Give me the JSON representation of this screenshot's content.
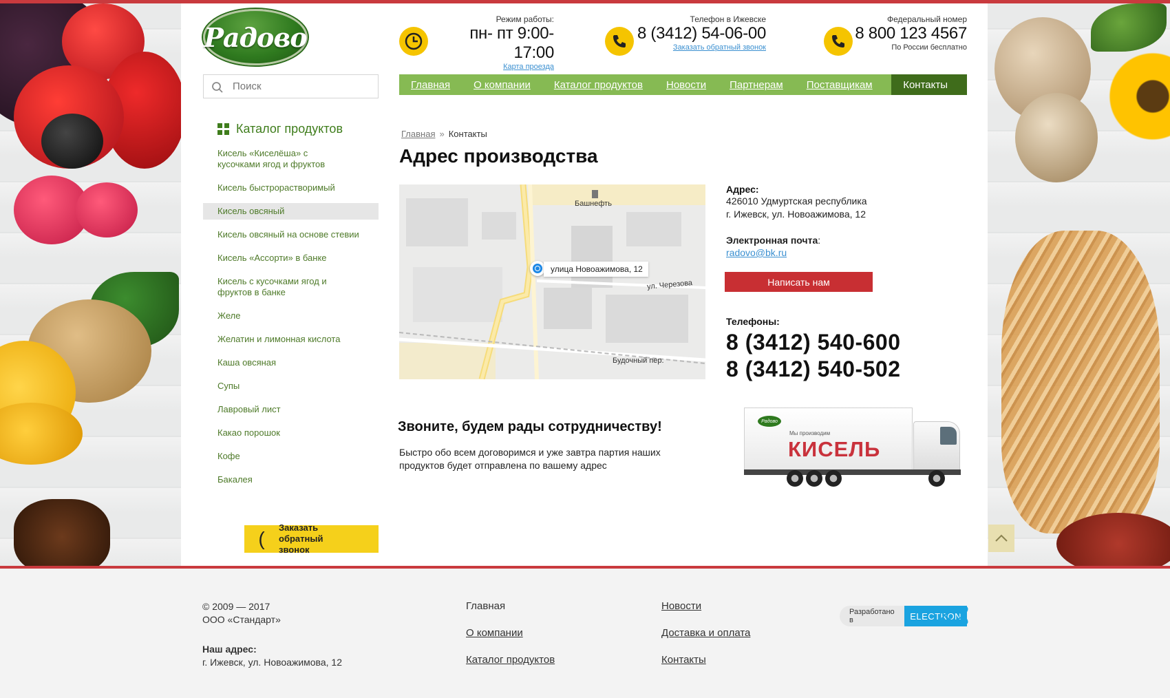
{
  "header": {
    "logo_text": "Радово",
    "hours": {
      "label": "Режим работы:",
      "value": "пн- пт 9:00-17:00",
      "link": "Карта проезда"
    },
    "city_phone": {
      "label": "Телефон в Ижевске",
      "value": "8 (3412) 54-06-00",
      "link": "Заказать обратный звонок"
    },
    "federal_phone": {
      "label": "Федеральный номер",
      "value": "8 800 123 4567",
      "sub": "По России бесплатно"
    }
  },
  "search": {
    "placeholder": "Поиск"
  },
  "nav": {
    "items": [
      "Главная",
      "О компании",
      "Каталог продуктов",
      "Новости",
      "Партнерам",
      "Поставщикам"
    ],
    "active": "Контакты"
  },
  "catalog": {
    "title": "Каталог продуктов",
    "items": [
      "Кисель «Киселёша» с кусочками ягод и фруктов",
      "Кисель быстрорастворимый",
      "Кисель овсяный",
      "Кисель овсяный на основе стевии",
      "Кисель «Ассорти» в банке",
      "Кисель с кусочками ягод и фруктов в банке",
      "Желе",
      "Желатин и лимонная кислота",
      "Каша овсяная",
      "Супы",
      "Лавровый лист",
      "Какао порошок",
      "Кофе",
      "Бакалея"
    ],
    "selected_index": 2
  },
  "callback_button": "Заказать обратный звонок",
  "breadcrumb": {
    "home": "Главная",
    "separator": "»",
    "current": "Контакты"
  },
  "page_title": "Адрес производства",
  "map": {
    "marker_label": "улица Новоажимова, 12",
    "labels": [
      "Башнефть",
      "ул. Черезова",
      "Будочный пер."
    ]
  },
  "contact": {
    "address_label": "Адрес:",
    "address_line1": "426010 Удмуртская республика",
    "address_line2": "г. Ижевск, ул. Новоажимова, 12",
    "email_label": "Электронная почта",
    "email_colon": ":",
    "email": "radovo@bk.ru",
    "write_button": "Написать нам",
    "phones_label": "Телефоны:",
    "phones": [
      "8 (3412) 540-600",
      "8 (3412) 540-502"
    ]
  },
  "promo": {
    "slogan": "Звоните, будем рады сотрудничеству!",
    "text": "Быстро обо всем договоримся и уже завтра партия наших продуктов будет отправлена по вашему адрес",
    "truck_small": "Мы производим",
    "truck_big": "КИСЕЛЬ",
    "truck_logo": "Радово"
  },
  "footer": {
    "copyright": "© 2009 — 2017",
    "company": "ООО «Стандарт»",
    "address_label": "Наш адрес:",
    "address": "г. Ижевск, ул. Новоажимова, 12",
    "links_col1": [
      "Главная",
      "О компании",
      "Каталог продуктов"
    ],
    "links_col2": [
      "Новости",
      "Доставка и оплата",
      "Контакты"
    ],
    "dev_label": "Разработано в",
    "dev_brand": "ELECTRON"
  },
  "colors": {
    "accent_red": "#c93a3e",
    "nav_green": "#86ba53",
    "nav_active": "#3f6c1b",
    "yellow": "#f5c400",
    "link_blue": "#3a8fd0"
  },
  "icons": [
    "clock-icon",
    "phone-icon",
    "search-icon",
    "catalog-grid-icon",
    "map-marker-icon",
    "arrow-up-icon",
    "electron-atom-icon"
  ]
}
